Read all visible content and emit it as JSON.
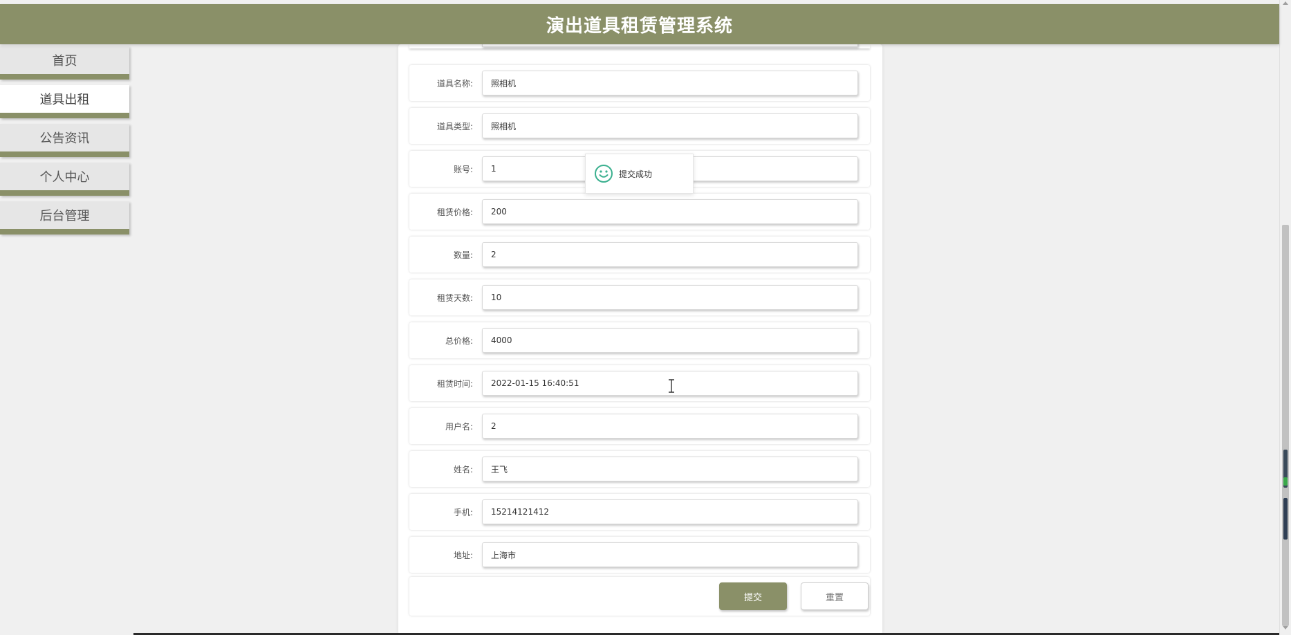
{
  "header": {
    "title": "演出道具租赁管理系统"
  },
  "sidebar": {
    "items": [
      {
        "label": "首页",
        "active": false
      },
      {
        "label": "道具出租",
        "active": true
      },
      {
        "label": "公告资讯",
        "active": false
      },
      {
        "label": "个人中心",
        "active": false
      },
      {
        "label": "后台管理",
        "active": false
      }
    ]
  },
  "form": {
    "fields": [
      {
        "label": "道具名称:",
        "value": "照相机"
      },
      {
        "label": "道具类型:",
        "value": "照相机"
      },
      {
        "label": "账号:",
        "value": "1"
      },
      {
        "label": "租赁价格:",
        "value": "200"
      },
      {
        "label": "数量:",
        "value": "2"
      },
      {
        "label": "租赁天数:",
        "value": "10"
      },
      {
        "label": "总价格:",
        "value": "4000"
      },
      {
        "label": "租赁时间:",
        "value": "2022-01-15 16:40:51"
      },
      {
        "label": "用户名:",
        "value": "2"
      },
      {
        "label": "姓名:",
        "value": "王飞"
      },
      {
        "label": "手机:",
        "value": "15214121412"
      },
      {
        "label": "地址:",
        "value": "上海市"
      }
    ],
    "submit_label": "提交",
    "reset_label": "重置"
  },
  "toast": {
    "message": "提交成功",
    "icon": "smiley-icon"
  },
  "colors": {
    "accent": "#8a9068",
    "background": "#f0f0f0",
    "toast_icon": "#3bb08f"
  }
}
